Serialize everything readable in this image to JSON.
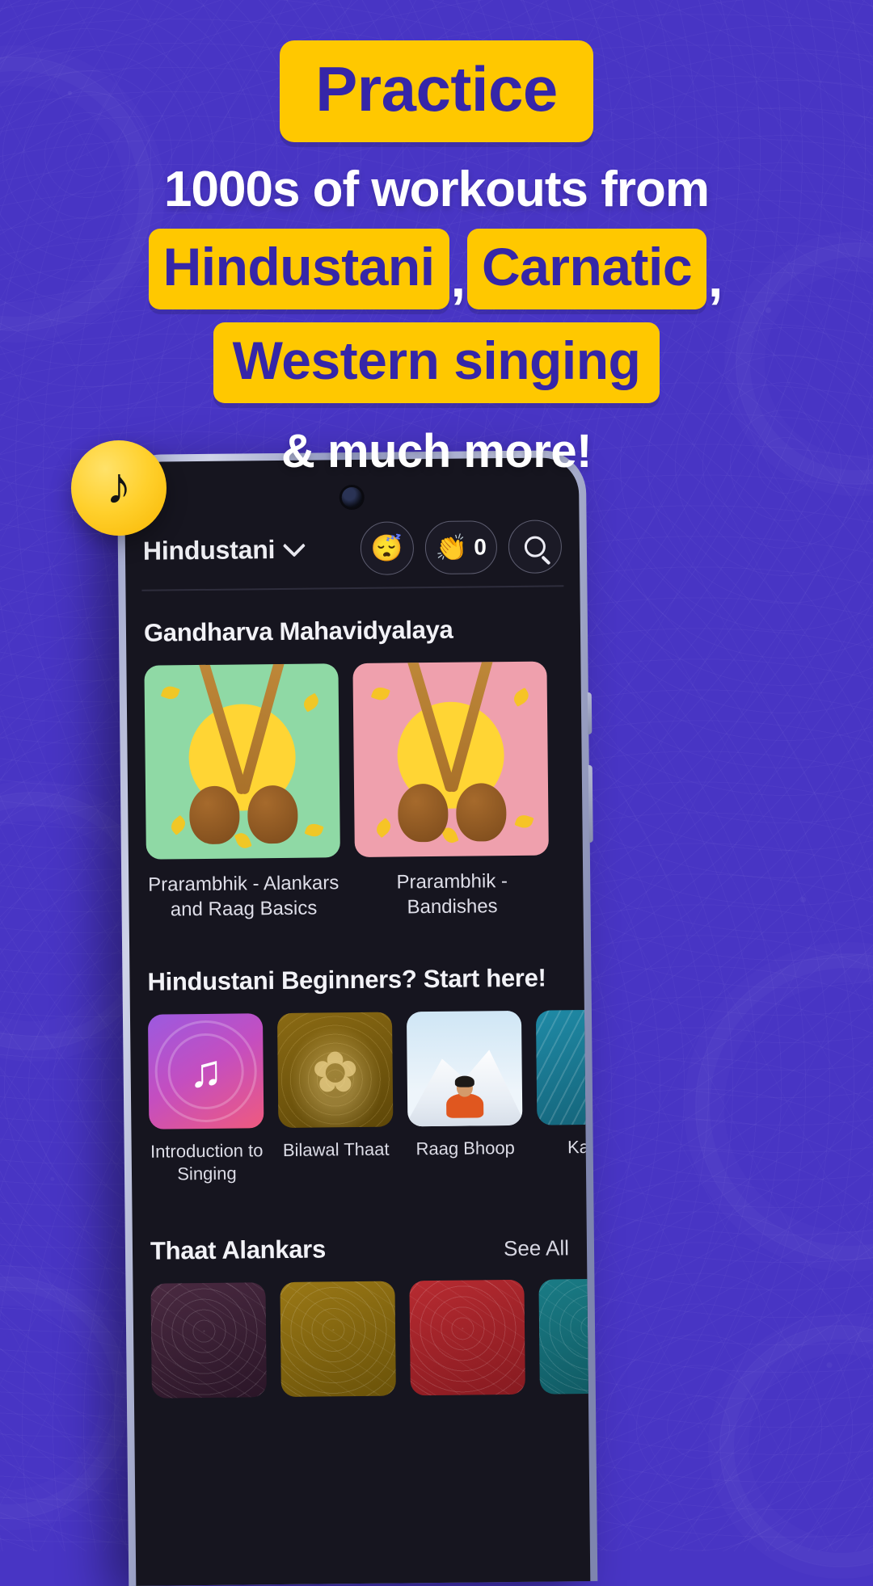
{
  "theme": {
    "background": "#4835c4",
    "accent_yellow": "#ffc800",
    "headline_purple": "#3526a8",
    "app_background": "#16151f"
  },
  "hero": {
    "badge_practice": "Practice",
    "line_workouts": "1000s of workouts from",
    "badge_hindustani": "Hindustani",
    "comma_1": ",",
    "badge_carnatic": "Carnatic",
    "comma_2": ",",
    "badge_western": "Western singing",
    "line_much_more": "& much more!"
  },
  "logo": {
    "icon": "music-note-icon",
    "glyph": "♪"
  },
  "app": {
    "header": {
      "language": "Hindustani",
      "chevron_icon": "chevron-down-icon",
      "profile_icon": "sleepy-face-emoji",
      "profile_glyph": "😴",
      "clap_icon": "clapping-hands-emoji",
      "clap_glyph": "👏",
      "clap_count": "0",
      "search_icon": "search-icon"
    },
    "sections": [
      {
        "title": "Gandharva Mahavidyalaya",
        "see_all": "",
        "card_size": "large",
        "cards": [
          {
            "label": "Prarambhik - Alankars and Raag Basics",
            "bg": "#8fd9a5",
            "art": "tanpura"
          },
          {
            "label": "Prarambhik - Bandishes",
            "bg": "#efa0ad",
            "art": "tanpura"
          }
        ]
      },
      {
        "title": "Hindustani Beginners? Start here!",
        "see_all": "",
        "card_size": "small",
        "cards": [
          {
            "label": "Introduction to Singing",
            "bg": "#b24ad1",
            "art": "ripple-note"
          },
          {
            "label": "Bilawal Thaat",
            "bg": "#7a5a12",
            "art": "peacock"
          },
          {
            "label": "Raag Bhoop",
            "bg": "#bcdcf0",
            "art": "mountain-monk"
          },
          {
            "label": "Kalyan",
            "bg": "#1d7f9c",
            "art": "waves"
          }
        ]
      },
      {
        "title": "Thaat Alankars",
        "see_all": "See All",
        "card_size": "small",
        "cards": [
          {
            "label": "",
            "bg": "#3a1f33",
            "art": "alankar"
          },
          {
            "label": "",
            "bg": "#7a6012",
            "art": "alankar"
          },
          {
            "label": "",
            "bg": "#a3242a",
            "art": "alankar"
          },
          {
            "label": "",
            "bg": "#17666d",
            "art": "alankar"
          }
        ]
      }
    ]
  }
}
